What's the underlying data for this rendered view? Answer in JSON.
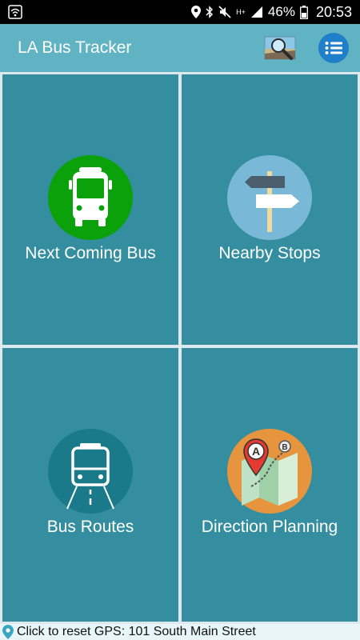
{
  "status_bar": {
    "battery_percent": "46%",
    "time": "20:53",
    "network": "H+",
    "icons": [
      "wifi-icon",
      "location-icon",
      "bluetooth-icon",
      "mute-icon",
      "signal-icon",
      "battery-icon"
    ]
  },
  "app_bar": {
    "title": "LA Bus Tracker",
    "search_icon": "map-search-icon",
    "menu_icon": "list-menu-icon"
  },
  "tiles": [
    {
      "label": "Next Coming Bus",
      "icon": "bus-front-icon",
      "icon_color": "#0aa10a"
    },
    {
      "label": "Nearby Stops",
      "icon": "signpost-icon",
      "icon_color": "#7ab8d8"
    },
    {
      "label": "Bus Routes",
      "icon": "bus-route-icon",
      "icon_color": "#1a7a89"
    },
    {
      "label": "Direction Planning",
      "icon": "map-directions-icon",
      "icon_color": "#e6953e"
    }
  ],
  "bottom_bar": {
    "text": "Click to reset GPS: 101 South Main Street",
    "icon": "location-pin-icon"
  },
  "colors": {
    "app_bar": "#5fb3c3",
    "tile": "#348e9f",
    "menu_button": "#1f7fc8"
  }
}
